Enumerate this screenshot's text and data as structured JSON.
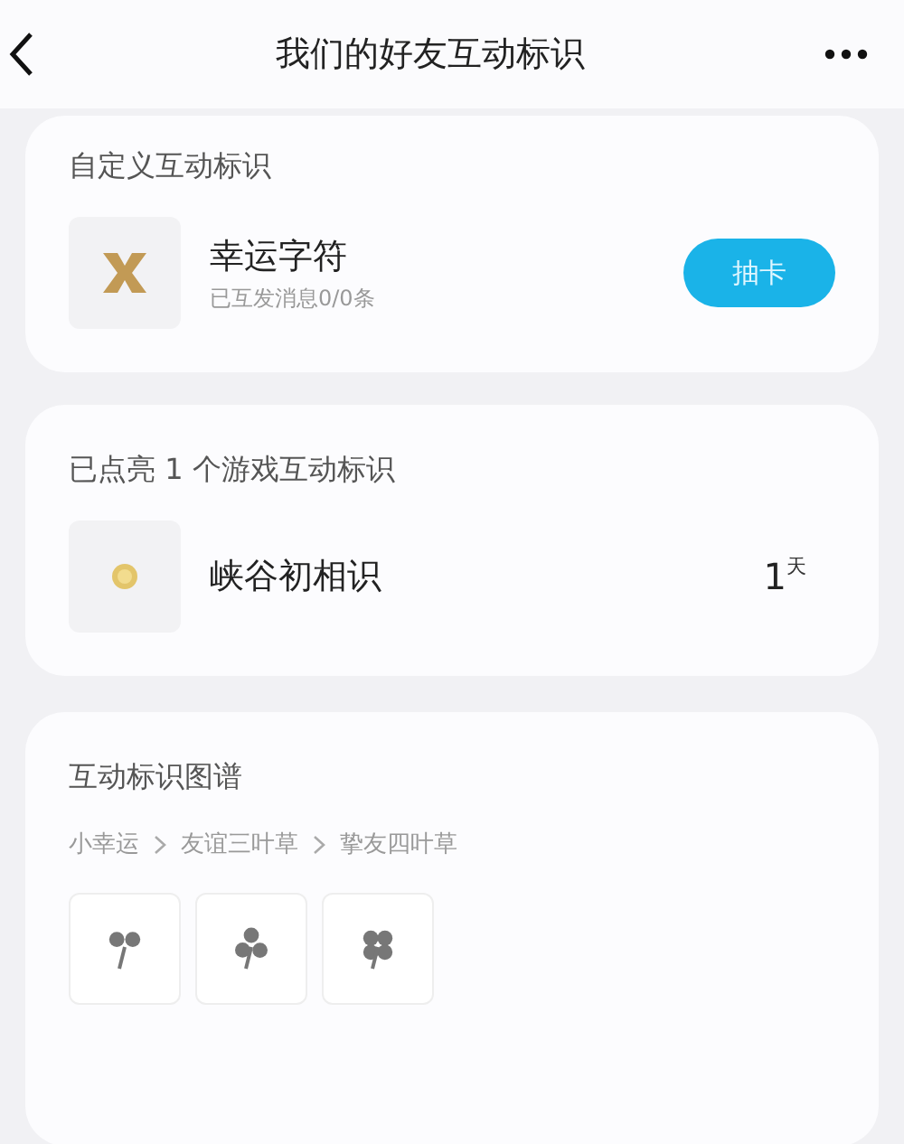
{
  "header": {
    "title": "我们的好友互动标识"
  },
  "custom": {
    "heading": "自定义互动标识",
    "name": "幸运字符",
    "subtitle": "已互发消息0/0条",
    "button": "抽卡"
  },
  "lit": {
    "heading": "已点亮 1 个游戏互动标识",
    "items": [
      {
        "name": "峡谷初相识",
        "days": "1",
        "unit": "天"
      }
    ]
  },
  "atlas": {
    "heading": "互动标识图谱",
    "stages": [
      {
        "label": "小幸运",
        "kind": "sprout"
      },
      {
        "label": "友谊三叶草",
        "kind": "trefoil"
      },
      {
        "label": "挚友四叶草",
        "kind": "quatrefoil"
      }
    ]
  }
}
